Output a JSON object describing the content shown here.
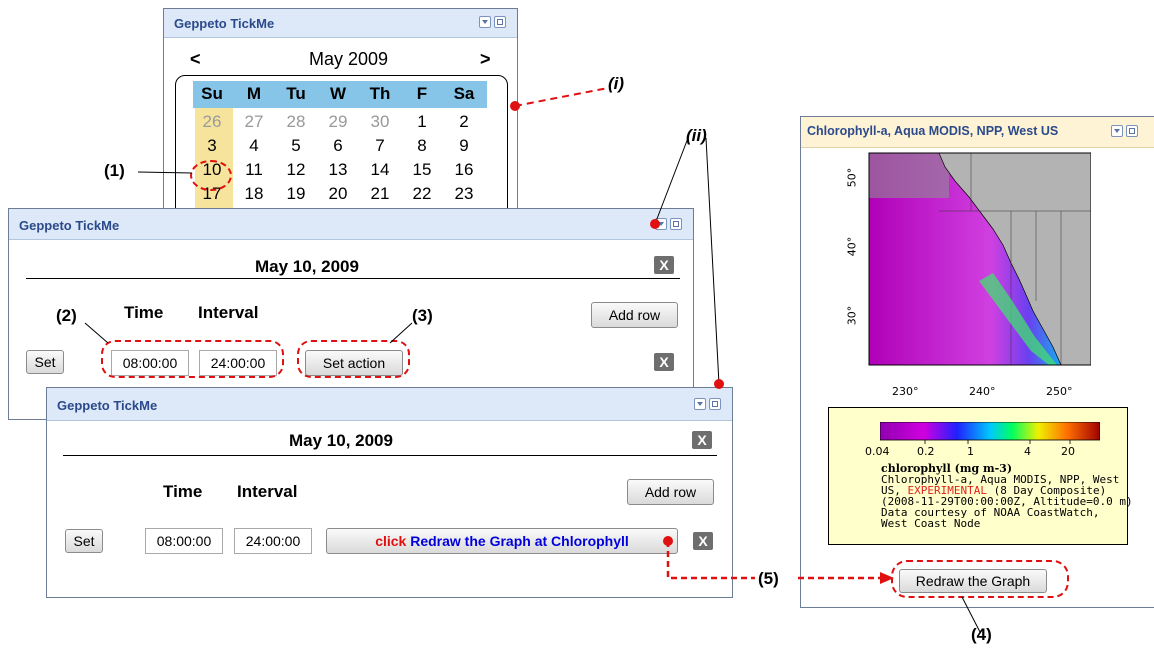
{
  "calendar": {
    "title": "Geppeto TickMe",
    "prev": "<",
    "next": ">",
    "month": "May 2009",
    "weekdays": [
      "Su",
      "M",
      "Tu",
      "W",
      "Th",
      "F",
      "Sa"
    ],
    "rows": [
      [
        "26",
        "27",
        "28",
        "29",
        "30",
        "1",
        "2"
      ],
      [
        "3",
        "4",
        "5",
        "6",
        "7",
        "8",
        "9"
      ],
      [
        "10",
        "11",
        "12",
        "13",
        "14",
        "15",
        "16"
      ],
      [
        "17",
        "18",
        "19",
        "20",
        "21",
        "22",
        "23"
      ]
    ]
  },
  "panel_ii": {
    "title": "Geppeto TickMe",
    "date": "May 10, 2009",
    "close": "X",
    "time_header": "Time",
    "interval_header": "Interval",
    "add_row": "Add row",
    "set": "Set",
    "time_value": "08:00:00",
    "interval_value": "24:00:00",
    "set_action": "Set action",
    "row_close": "X"
  },
  "panel_iii": {
    "title": "Geppeto TickMe",
    "date": "May 10, 2009",
    "close": "X",
    "time_header": "Time",
    "interval_header": "Interval",
    "add_row": "Add row",
    "set": "Set",
    "time_value": "08:00:00",
    "interval_value": "24:00:00",
    "action_prefix": "click",
    "action_text": "Redraw the Graph at Chlorophyll",
    "row_close": "X"
  },
  "chlorophyll": {
    "title": "Chlorophyll-a, Aqua MODIS, NPP, West US",
    "lat_labels": [
      "50°",
      "40°",
      "30°"
    ],
    "lon_labels": [
      "230°",
      "240°",
      "250°"
    ],
    "colorbar_ticks": [
      "0.04",
      "0.2",
      "1",
      "4",
      "20"
    ],
    "legend_title": "chlorophyll (mg m-3)",
    "legend_line1": "Chlorophyll-a, Aqua MODIS, NPP, West",
    "legend_line2a": "US, ",
    "legend_line2b": "EXPERIMENTAL",
    "legend_line2c": " (8 Day Composite)",
    "legend_line3": "(2008-11-29T00:00:00Z, Altitude=0.0 m)",
    "legend_line4": "Data courtesy of NOAA CoastWatch,",
    "legend_line5": "West Coast Node",
    "redraw_button": "Redraw the Graph",
    "experimental_color": "#e02020"
  },
  "annotations": {
    "i": "(i)",
    "ii": "(ii)",
    "n1": "(1)",
    "n2": "(2)",
    "n3": "(3)",
    "n4": "(4)",
    "n5": "(5)"
  },
  "colors": {
    "titlebar": "#dde9f8",
    "title_text": "#2b4a8b",
    "calendar_header": "#86c5e8",
    "sunday_column": "#f7e49c",
    "annotation_red": "#e01010",
    "action_blue": "#0000dd"
  }
}
